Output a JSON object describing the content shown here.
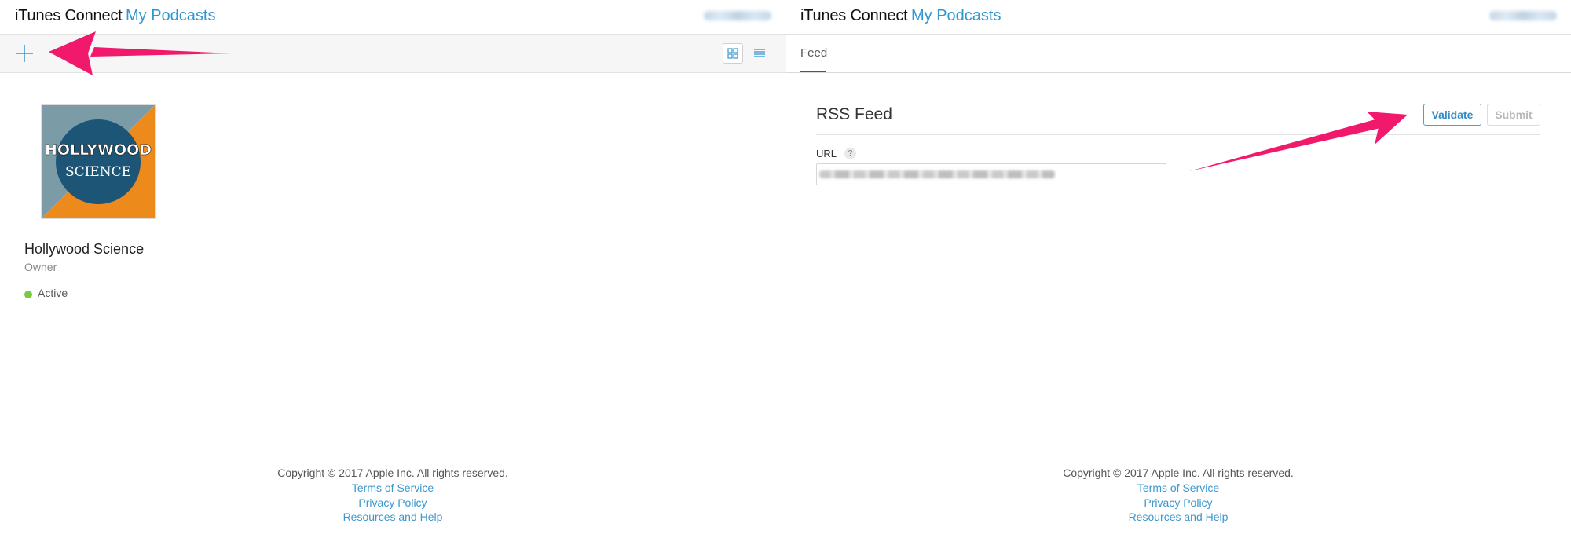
{
  "left": {
    "header": {
      "brand": "iTunes Connect",
      "section": "My Podcasts"
    },
    "toolbar": {
      "add_icon": "plus-icon",
      "grid_icon": "grid-view-icon",
      "list_icon": "list-view-icon"
    },
    "podcast": {
      "artwork_line1": "HOLLYWOOD",
      "artwork_line2": "SCIENCE",
      "title": "Hollywood Science",
      "role": "Owner",
      "status": "Active",
      "status_color": "#7ac943"
    },
    "footer": {
      "copyright": "Copyright © 2017 Apple Inc. All rights reserved.",
      "links": [
        "Terms of Service",
        "Privacy Policy",
        "Resources and Help"
      ]
    }
  },
  "right": {
    "header": {
      "brand": "iTunes Connect",
      "section": "My Podcasts"
    },
    "tabs": [
      {
        "label": "Feed",
        "active": true
      }
    ],
    "rss": {
      "title": "RSS Feed",
      "validate_label": "Validate",
      "submit_label": "Submit",
      "url_label": "URL",
      "help_glyph": "?"
    },
    "footer": {
      "copyright": "Copyright © 2017 Apple Inc. All rights reserved.",
      "links": [
        "Terms of Service",
        "Privacy Policy",
        "Resources and Help"
      ]
    }
  },
  "colors": {
    "accent": "#2f97d0",
    "annotation_arrow": "#f0196b",
    "active_status": "#7ac943"
  }
}
